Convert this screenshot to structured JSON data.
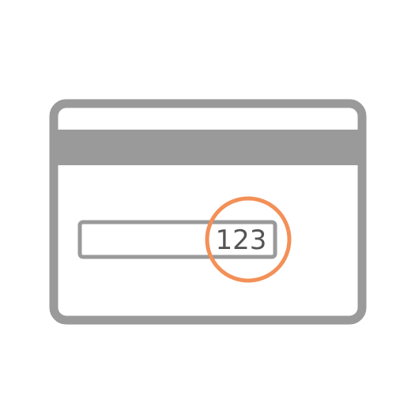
{
  "card_back_illustration": {
    "icon": "credit-card-back-icon",
    "cvv_digits": "123",
    "colors": {
      "card_outline": "#9a9a9a",
      "card_fill": "#ffffff",
      "magnetic_stripe": "#9a9a9a",
      "highlight_circle": "#f39057",
      "digits": "#555555"
    }
  }
}
